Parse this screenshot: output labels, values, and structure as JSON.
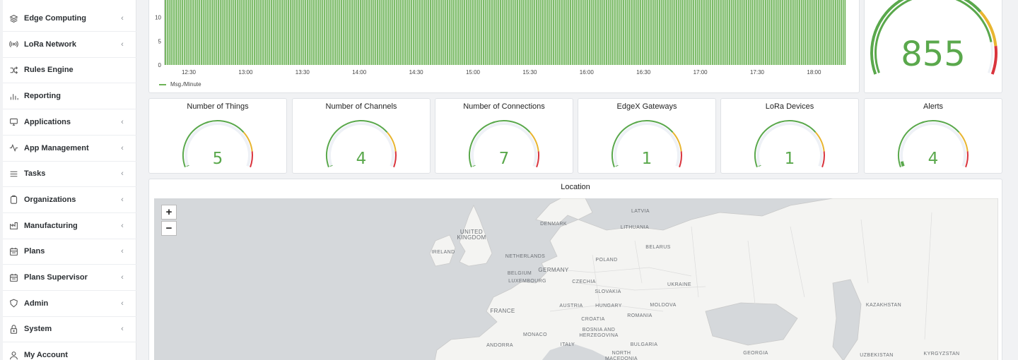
{
  "sidebar": {
    "items": [
      {
        "label": "Edge Computing",
        "icon": "layers-icon",
        "chevron": "‹"
      },
      {
        "label": "LoRa Network",
        "icon": "broadcast-icon",
        "chevron": "‹"
      },
      {
        "label": "Rules Engine",
        "icon": "shuffle-icon",
        "chevron": ""
      },
      {
        "label": "Reporting",
        "icon": "bar-chart-icon",
        "chevron": ""
      },
      {
        "label": "Applications",
        "icon": "monitor-icon",
        "chevron": "‹"
      },
      {
        "label": "App Management",
        "icon": "activity-icon",
        "chevron": "‹"
      },
      {
        "label": "Tasks",
        "icon": "list-icon",
        "chevron": "‹"
      },
      {
        "label": "Organizations",
        "icon": "clipboard-icon",
        "chevron": "‹"
      },
      {
        "label": "Manufacturing",
        "icon": "factory-icon",
        "chevron": "‹"
      },
      {
        "label": "Plans",
        "icon": "calendar-icon",
        "chevron": "‹"
      },
      {
        "label": "Plans Supervisor",
        "icon": "calendar-icon",
        "chevron": "‹"
      },
      {
        "label": "Admin",
        "icon": "shield-icon",
        "chevron": "‹"
      },
      {
        "label": "System",
        "icon": "lock-icon",
        "chevron": "‹"
      },
      {
        "label": "My Account",
        "icon": "user-icon",
        "chevron": ""
      }
    ]
  },
  "chart": {
    "legend": "Msg./Minute",
    "color": "#6cb356"
  },
  "chart_data": {
    "type": "bar",
    "title": "",
    "xlabel": "",
    "ylabel": "",
    "ylim": [
      0,
      15
    ],
    "yticks": [
      "0",
      "5",
      "10"
    ],
    "xticks": [
      "12:30",
      "13:00",
      "13:30",
      "14:00",
      "14:30",
      "15:00",
      "15:30",
      "16:00",
      "16:30",
      "17:00",
      "17:30",
      "18:00"
    ],
    "series": [
      {
        "name": "Msg./Minute",
        "value_per_minute": 15
      }
    ],
    "legend_position": "bottom-left",
    "grid": false
  },
  "big_gauge": {
    "value": "855",
    "fraction": 0.86
  },
  "gauges": [
    {
      "title": "Number of Things",
      "value": "5",
      "fraction": 0.0
    },
    {
      "title": "Number of Channels",
      "value": "4",
      "fraction": 0.0
    },
    {
      "title": "Number of Connections",
      "value": "7",
      "fraction": 0.0
    },
    {
      "title": "EdgeX Gateways",
      "value": "1",
      "fraction": 0.0
    },
    {
      "title": "LoRa Devices",
      "value": "1",
      "fraction": 0.0
    },
    {
      "title": "Alerts",
      "value": "4",
      "fraction": 0.04
    }
  ],
  "map": {
    "title": "Location",
    "zoom_in": "+",
    "zoom_out": "−",
    "countries": [
      "LATVIA",
      "DENMARK",
      "LITHUANIA",
      "UNITED KINGDOM",
      "BELARUS",
      "IRELAND",
      "NETHERLANDS",
      "POLAND",
      "BELGIUM",
      "GERMANY",
      "LUXEMBOURG",
      "CZECHIA",
      "UKRAINE",
      "SLOVAKIA",
      "FRANCE",
      "AUSTRIA",
      "HUNGARY",
      "MOLDOVA",
      "KAZAKHSTAN",
      "ROMANIA",
      "CROATIA",
      "BOSNIA AND HERZEGOVINA",
      "MONACO",
      "ITALY",
      "ANDORRA",
      "BULGARIA",
      "NORTH MACEDONIA",
      "GEORGIA",
      "UZBEKISTAN",
      "KYRGYZSTAN"
    ]
  }
}
